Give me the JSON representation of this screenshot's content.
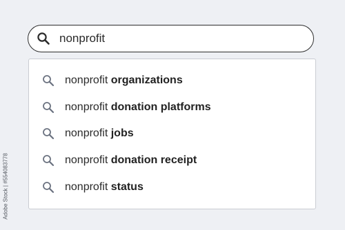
{
  "colors": {
    "background": "#eef0f4",
    "icon_gray": "#6b7280",
    "icon_dark": "#2b2b2b",
    "text": "#2a2a2a"
  },
  "search": {
    "icon": "search-icon",
    "value": "nonprofit"
  },
  "suggestions": [
    {
      "icon": "search-icon",
      "prefix": "nonprofit",
      "completion": "organizations"
    },
    {
      "icon": "search-icon",
      "prefix": "nonprofit",
      "completion": "donation platforms"
    },
    {
      "icon": "search-icon",
      "prefix": "nonprofit",
      "completion": "jobs"
    },
    {
      "icon": "search-icon",
      "prefix": "nonprofit",
      "completion": "donation receipt"
    },
    {
      "icon": "search-icon",
      "prefix": "nonprofit",
      "completion": "status"
    }
  ],
  "side_credit": "Adobe Stock | #554083778"
}
